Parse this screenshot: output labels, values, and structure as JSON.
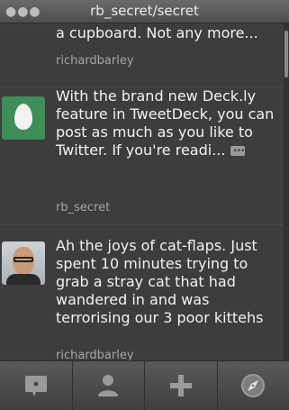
{
  "titlebar": {
    "title": "rb_secret/secret"
  },
  "tweets": [
    {
      "text": "a cupboard. Not any more...",
      "user": "richardbarley"
    },
    {
      "text": "With the brand new Deck.ly feature in TweetDeck, you can post as much as you like to Twitter. If you're readi...",
      "user": "rb_secret"
    },
    {
      "text": "Ah the joys of cat-flaps. Just spent 10 minutes trying to grab a stray cat that had wandered in and was terrorising our 3 poor kittehs",
      "user": "richardbarley"
    }
  ],
  "icons": {
    "tab1": "compose-message-icon",
    "tab2": "profile-icon",
    "tab3": "add-column-icon",
    "tab4": "compass-icon"
  },
  "colors": {
    "egg_avatar": "#3e8e5a"
  }
}
